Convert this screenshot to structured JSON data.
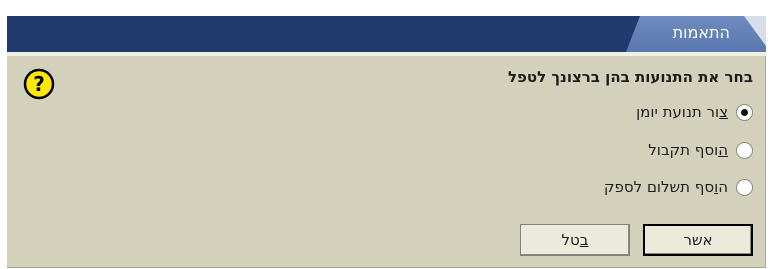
{
  "window": {
    "title": "התאמות"
  },
  "prompt": "בחר את התנועות בהן ברצונך לטפל",
  "options": [
    {
      "label_before": "",
      "label_accel": "צ",
      "label_after": "ור תנועת יומן",
      "checked": true
    },
    {
      "label_before": "",
      "label_accel": "ה",
      "label_after": "וסף תקבול",
      "checked": false
    },
    {
      "label_before": "ה",
      "label_accel": "ו",
      "label_after": "סף תשלום לספק",
      "checked": false
    }
  ],
  "buttons": {
    "ok_label": "אשר",
    "cancel_before": "",
    "cancel_accel": "ב",
    "cancel_after": "טל"
  },
  "icons": {
    "help": "question-icon"
  },
  "colors": {
    "titlebar": "#223a6e",
    "title_tab": "#6f8bbf",
    "dialog_bg": "#d3d1bc",
    "help_icon_fill": "#ffe800"
  }
}
